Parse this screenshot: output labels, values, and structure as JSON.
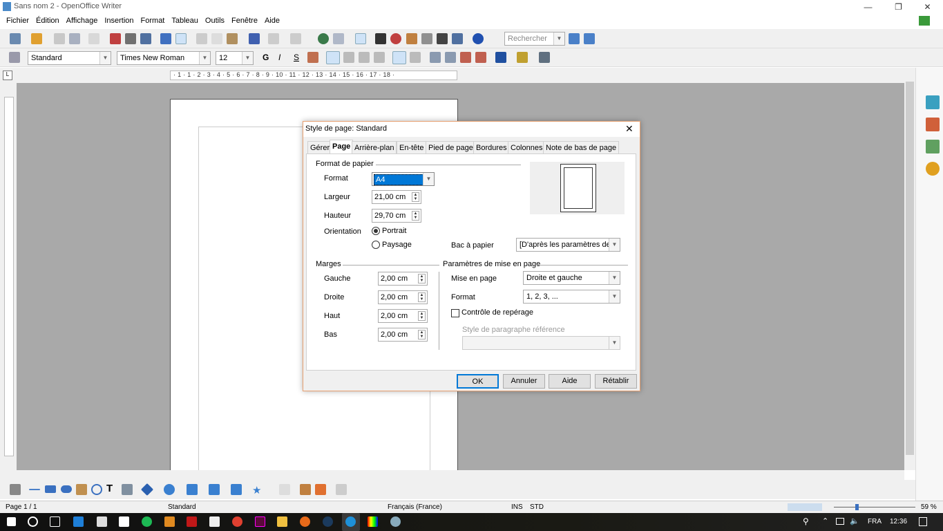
{
  "window": {
    "title": "Sans nom 2 - OpenOffice Writer",
    "minimize": "—",
    "maximize": "❐",
    "close": "✕"
  },
  "menu": [
    "Fichier",
    "Édition",
    "Affichage",
    "Insertion",
    "Format",
    "Tableau",
    "Outils",
    "Fenêtre",
    "Aide"
  ],
  "toolbar": {
    "search_placeholder": "Rechercher"
  },
  "formatting": {
    "style": "Standard",
    "font": "Times New Roman",
    "size": "12",
    "bold": "G",
    "italic": "I",
    "shadow": "S"
  },
  "ruler": {
    "marks": "· 1 · 1 · 2 · 3 · 4 · 5 · 6 · 7 · 8 · 9 · 10 · 11 · 12 · 13 · 14 · 15 · 16 · 17 · 18 ·"
  },
  "dialog": {
    "title": "Style de page: Standard",
    "tabs": [
      "Gérer",
      "Page",
      "Arrière-plan",
      "En-tête",
      "Pied de page",
      "Bordures",
      "Colonnes",
      "Note de bas de page"
    ],
    "active_tab": "Page",
    "paper_section": "Format de papier",
    "format_label": "Format",
    "format_value": "A4",
    "width_label": "Largeur",
    "width_value": "21,00 cm",
    "height_label": "Hauteur",
    "height_value": "29,70 cm",
    "orientation_label": "Orientation",
    "portrait": "Portrait",
    "landscape": "Paysage",
    "orientation_selected": "Portrait",
    "tray_label": "Bac à papier",
    "tray_value": "[D'après les paramètres de l'",
    "margins_section": "Marges",
    "left_label": "Gauche",
    "left_value": "2,00 cm",
    "right_label": "Droite",
    "right_value": "2,00 cm",
    "top_label": "Haut",
    "top_value": "2,00 cm",
    "bottom_label": "Bas",
    "bottom_value": "2,00 cm",
    "layout_section": "Paramètres de mise en page",
    "layout_label": "Mise en page",
    "layout_value": "Droite et gauche",
    "numformat_label": "Format",
    "numformat_value": "1, 2, 3, ...",
    "register_label": "Contrôle de repérage",
    "register_checked": false,
    "refstyle_label": "Style de paragraphe référence",
    "refstyle_value": "",
    "ok": "OK",
    "cancel": "Annuler",
    "help": "Aide",
    "reset": "Rétablir"
  },
  "status": {
    "page": "Page 1 / 1",
    "style": "Standard",
    "language": "Français (France)",
    "ins": "INS",
    "std": "STD",
    "zoom": "59 %",
    "zoom_level": 59
  },
  "taskbar": {
    "lang": "FRA",
    "time": "12:36"
  },
  "colors": {
    "accent": "#0078d7",
    "dialog_border": "#e8a070",
    "doc_bg": "#a9a9a9"
  }
}
